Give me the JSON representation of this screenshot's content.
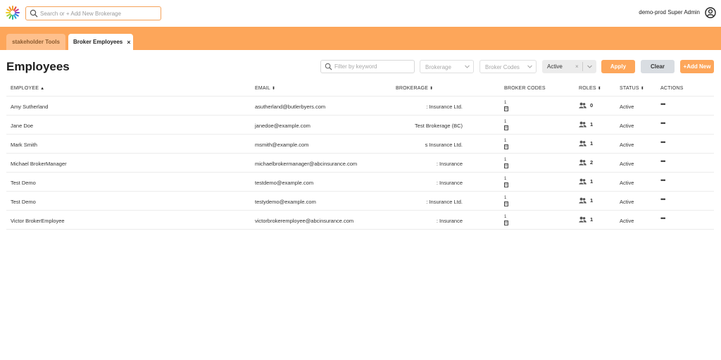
{
  "header": {
    "search_placeholder": "Search or + Add New Brokerage",
    "user_name": "demo-prod Super Admin"
  },
  "tabs": [
    {
      "label": "stakeholder Tools",
      "active": false
    },
    {
      "label": "Broker Employees",
      "active": true,
      "close": "×"
    }
  ],
  "page_title": "Employees",
  "filters": {
    "keyword_placeholder": "Filter by keyword",
    "brokerage_placeholder": "Brokerage",
    "broker_codes_placeholder": "Broker Codes",
    "status_value": "Active",
    "clear_glyph": "×",
    "apply_label": "Apply",
    "clear_label": "Clear",
    "add_label": "+Add New"
  },
  "table": {
    "columns": {
      "employee": "EMPLOYEE",
      "email": "EMAIL",
      "brokerage": "BROKERAGE",
      "broker_codes": "BROKER CODES",
      "roles": "ROLES",
      "status": "STATUS",
      "actions": "ACTIONS"
    },
    "sort_asc": "▲",
    "sort_both": "⬍",
    "rows": [
      {
        "employee": "Amy Sutherland",
        "email": "asutherland@butlerbyers.com",
        "brokerage": ": Insurance Ltd.",
        "codes": "1",
        "roles": "0",
        "status": "Active",
        "actions": "•••"
      },
      {
        "employee": "Jane Doe",
        "email": "janedoe@example.com",
        "brokerage": "Test Brokerage (BC)",
        "codes": "1",
        "roles": "1",
        "status": "Active",
        "actions": "•••"
      },
      {
        "employee": "Mark Smith",
        "email": "msmith@example.com",
        "brokerage": "s Insurance Ltd.",
        "codes": "1",
        "roles": "1",
        "status": "Active",
        "actions": "•••"
      },
      {
        "employee": "Michael BrokerManager",
        "email": "michaelbrokermanager@abcinsurance.com",
        "brokerage": ": Insurance",
        "codes": "1",
        "roles": "2",
        "status": "Active",
        "actions": "•••"
      },
      {
        "employee": "Test Demo",
        "email": "testdemo@example.com",
        "brokerage": ": Insurance",
        "codes": "1",
        "roles": "1",
        "status": "Active",
        "actions": "•••"
      },
      {
        "employee": "Test Demo",
        "email": "testydemo@example.com",
        "brokerage": ": Insurance Ltd.",
        "codes": "1",
        "roles": "1",
        "status": "Active",
        "actions": "•••"
      },
      {
        "employee": "Victor BrokerEmployee",
        "email": "victorbrokeremployee@abcinsurance.com",
        "brokerage": ": Insurance",
        "codes": "1",
        "roles": "1",
        "status": "Active",
        "actions": "•••"
      }
    ]
  },
  "colors": {
    "accent": "#fda65a",
    "tab_inactive": "#fec08d",
    "clear_button": "#d9dde2"
  },
  "icons": [
    "logo-icon",
    "search-icon",
    "user-icon",
    "chevron-down-icon",
    "building-icon",
    "users-icon"
  ]
}
